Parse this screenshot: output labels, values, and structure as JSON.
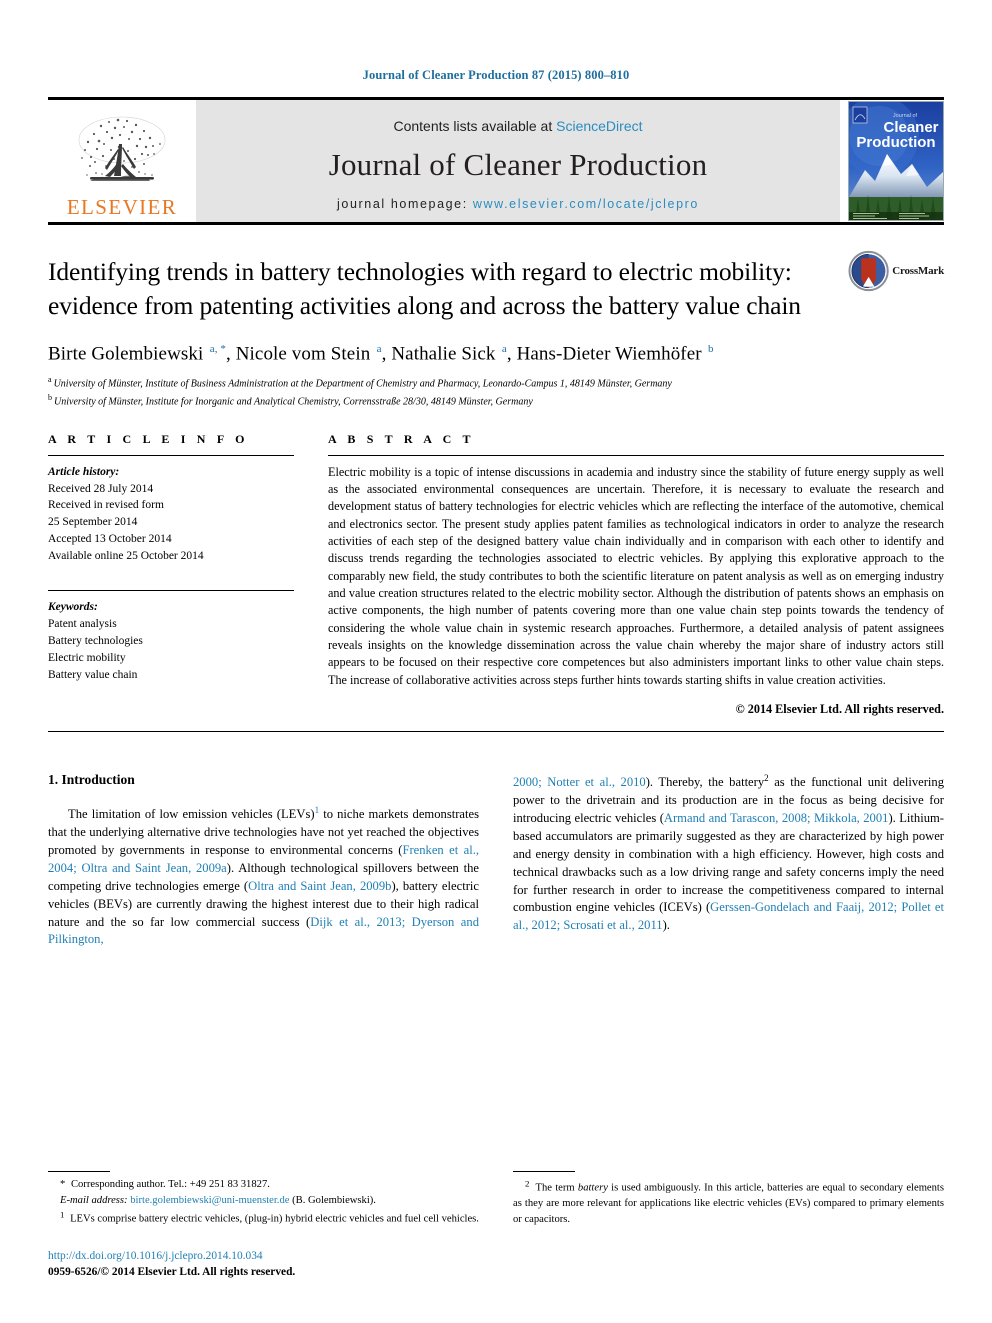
{
  "running_head": "Journal of Cleaner Production 87 (2015) 800–810",
  "masthead": {
    "publisher_name": "ELSEVIER",
    "contents_prefix": "Contents lists available at ",
    "contents_link": "ScienceDirect",
    "journal_title": "Journal of Cleaner Production",
    "homepage_prefix": "journal homepage: ",
    "homepage_url": "www.elsevier.com/locate/jclepro",
    "cover": {
      "line1": "Journal of",
      "line2": "Cleaner",
      "line3": "Production"
    }
  },
  "article": {
    "title": "Identifying trends in battery technologies with regard to electric mobility: evidence from patenting activities along and across the battery value chain",
    "crossmark_label": "CrossMark",
    "authors_html": "Birte Golembiewski <sup>a, *</sup>, Nicole vom Stein <sup>a</sup>, Nathalie Sick <sup>a</sup>, Hans-Dieter Wiemhöfer <sup>b</sup>",
    "affiliations": [
      {
        "marker": "a",
        "text": "University of Münster, Institute of Business Administration at the Department of Chemistry and Pharmacy, Leonardo-Campus 1, 48149 Münster, Germany"
      },
      {
        "marker": "b",
        "text": "University of Münster, Institute for Inorganic and Analytical Chemistry, Corrensstraße 28/30, 48149 Münster, Germany"
      }
    ]
  },
  "article_info": {
    "heading": "A R T I C L E   I N F O",
    "history_label": "Article history:",
    "history": [
      "Received 28 July 2014",
      "Received in revised form",
      "25 September 2014",
      "Accepted 13 October 2014",
      "Available online 25 October 2014"
    ],
    "keywords_label": "Keywords:",
    "keywords": [
      "Patent analysis",
      "Battery technologies",
      "Electric mobility",
      "Battery value chain"
    ]
  },
  "abstract": {
    "heading": "A B S T R A C T",
    "text": "Electric mobility is a topic of intense discussions in academia and industry since the stability of future energy supply as well as the associated environmental consequences are uncertain. Therefore, it is necessary to evaluate the research and development status of battery technologies for electric vehicles which are reflecting the interface of the automotive, chemical and electronics sector. The present study applies patent families as technological indicators in order to analyze the research activities of each step of the designed battery value chain individually and in comparison with each other to identify and discuss trends regarding the technologies associated to electric vehicles. By applying this explorative approach to the comparably new field, the study contributes to both the scientific literature on patent analysis as well as on emerging industry and value creation structures related to the electric mobility sector. Although the distribution of patents shows an emphasis on active components, the high number of patents covering more than one value chain step points towards the tendency of considering the whole value chain in systemic research approaches. Furthermore, a detailed analysis of patent assignees reveals insights on the knowledge dissemination across the value chain whereby the major share of industry actors still appears to be focused on their respective core competences but also administers important links to other value chain steps. The increase of collaborative activities across steps further hints towards starting shifts in value creation activities.",
    "copyright": "© 2014 Elsevier Ltd. All rights reserved."
  },
  "introduction": {
    "heading": "1. Introduction",
    "left_column_html": "The limitation of low emission vehicles (LEVs)<sup class=\"fnref\">1</sup> to niche markets demonstrates that the underlying alternative drive technologies have not yet reached the objectives promoted by governments in response to environmental concerns (<span class=\"cit\">Frenken et al., 2004; Oltra and Saint Jean, 2009a</span>). Although technological spillovers between the competing drive technologies emerge (<span class=\"cit\">Oltra and Saint Jean, 2009b</span>), battery electric vehicles (BEVs) are currently drawing the highest interest due to their high radical nature and the so far low commercial success (<span class=\"cit\">Dijk et al., 2013; Dyerson and Pilkington,</span>",
    "right_column_html": "<span class=\"cit\">2000; Notter et al., 2010</span>). Thereby, the battery<sup class=\"fnref-blk\">2</sup> as the functional unit delivering power to the drivetrain and its production are in the focus as being decisive for introducing electric vehicles (<span class=\"cit\">Armand and Tarascon, 2008; Mikkola, 2001</span>). Lithium-based accumulators are primarily suggested as they are characterized by high power and energy density in combination with a high efficiency. However, high costs and technical drawbacks such as a low driving range and safety concerns imply the need for further research in order to increase the competitiveness compared to internal combustion engine vehicles (ICEVs) (<span class=\"cit\">Gerssen-Gondelach and Faaij, 2012; Pollet et al., 2012; Scrosati et al., 2011</span>)."
  },
  "footnotes": {
    "corresponding_html": "<span class=\"marker\">*</span> Corresponding author. Tel.: +49 251 83 31827.",
    "email_html": "<span class=\"em\">E-mail address:</span> <span class=\"link\">birte.golembiewski@uni-muenster.de</span> (B. Golembiewski).",
    "note1_html": "<span class=\"marker\"><sup>1</sup></span> LEVs comprise battery electric vehicles, (plug-in) hybrid electric vehicles and fuel cell vehicles.",
    "note2_html": "<span class=\"marker\"><sup>2</sup></span> The term <span class=\"em\">battery</span> is used ambiguously. In this article, batteries are equal to secondary elements as they are more relevant for applications like electric vehicles (EVs) compared to primary elements or capacitors.",
    "doi": "http://dx.doi.org/10.1016/j.jclepro.2014.10.034",
    "issn": "0959-6526/© 2014 Elsevier Ltd. All rights reserved."
  },
  "colors": {
    "link_blue": "#1f7fb5",
    "sciencedirect_blue": "#2b8cbe",
    "elsevier_orange": "#E87722",
    "masthead_gray": "#e4e4e4"
  }
}
